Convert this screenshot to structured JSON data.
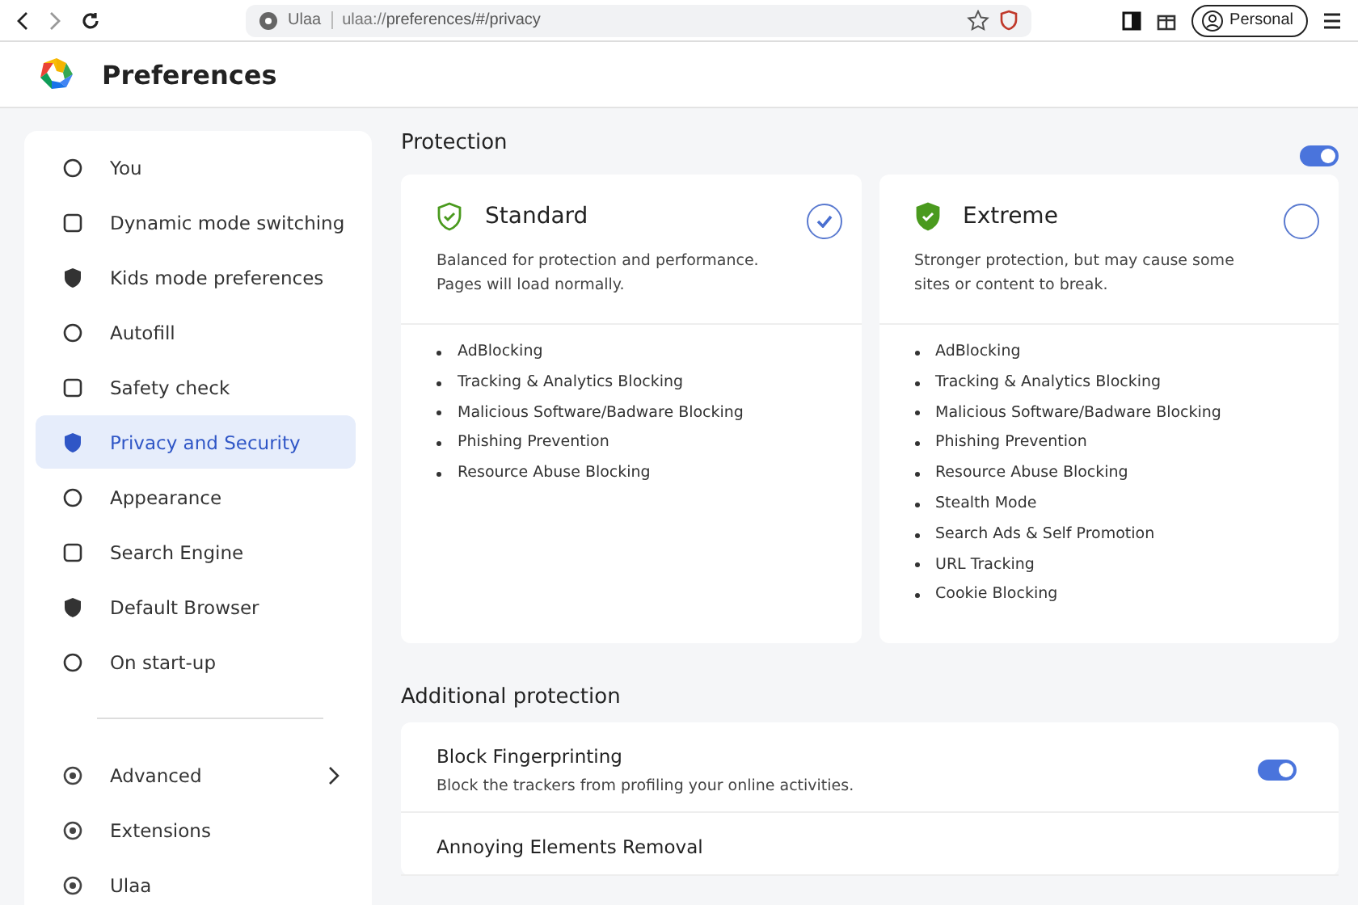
{
  "browser": {
    "site_label": "Ulaa",
    "url_host": "ulaa://",
    "url_path": "preferences/#/privacy",
    "profile": "Personal"
  },
  "header": {
    "title": "Preferences"
  },
  "sidebar": {
    "items": [
      {
        "label": "You",
        "selected": false
      },
      {
        "label": "Dynamic mode switching",
        "selected": false
      },
      {
        "label": "Kids mode preferences",
        "selected": false
      },
      {
        "label": "Autofill",
        "selected": false
      },
      {
        "label": "Safety check",
        "selected": false
      },
      {
        "label": "Privacy and Security",
        "selected": true
      },
      {
        "label": "Appearance",
        "selected": false
      },
      {
        "label": "Search Engine",
        "selected": false
      },
      {
        "label": "Default Browser",
        "selected": false
      },
      {
        "label": "On start-up",
        "selected": false
      }
    ],
    "extra_items": [
      {
        "label": "Advanced",
        "expandable": true
      },
      {
        "label": "Extensions",
        "expandable": false
      },
      {
        "label": "Ulaa",
        "expandable": false
      }
    ]
  },
  "protection": {
    "title": "Protection",
    "on": true,
    "modes": [
      {
        "name": "Standard",
        "selected": true,
        "description": "Balanced for protection and performance. Pages will load normally.",
        "features": [
          "AdBlocking",
          "Tracking & Analytics Blocking",
          "Malicious Software/Badware Blocking",
          "Phishing Prevention",
          "Resource Abuse Blocking"
        ]
      },
      {
        "name": "Extreme",
        "selected": false,
        "description": "Stronger protection, but may cause some sites or content to break.",
        "features": [
          "AdBlocking",
          "Tracking & Analytics Blocking",
          "Malicious Software/Badware Blocking",
          "Phishing Prevention",
          "Resource Abuse Blocking",
          "Stealth Mode",
          "Search Ads & Self Promotion",
          "URL Tracking",
          "Cookie Blocking"
        ]
      }
    ]
  },
  "additional": {
    "title": "Additional protection",
    "settings": [
      {
        "title": "Block Fingerprinting",
        "description": "Block the trackers from profiling your online activities.",
        "on": true
      },
      {
        "title": "Annoying Elements Removal"
      }
    ]
  }
}
